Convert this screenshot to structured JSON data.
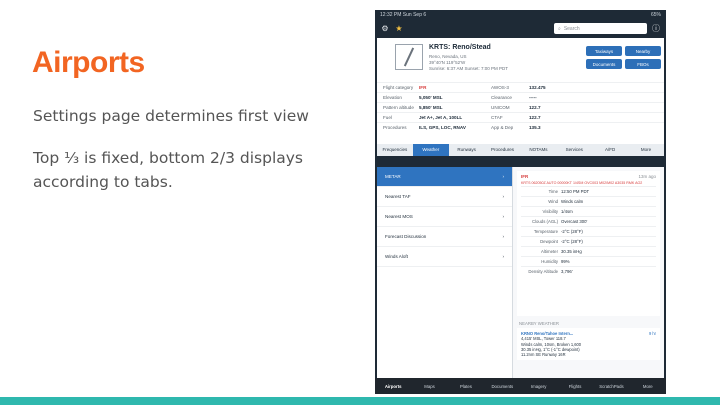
{
  "slide": {
    "title": "Airports",
    "line1": "Settings page determines first view",
    "line2": "Top ⅓ is fixed, bottom 2/3 displays according to tabs."
  },
  "colors": {
    "title": "#f26522",
    "accent_bar": "#2fb8ae",
    "ipad_bg": "#1e2a36",
    "active_blue": "#2f74c0"
  },
  "ipad": {
    "status_left": "12:32 PM  Sun Sep 6",
    "status_right": "65%",
    "search_placeholder": "Search",
    "airport": {
      "title": "KRTS: Reno/Stead",
      "line1": "Reno, Nevada, US",
      "line2": "39°40'N 119°52'W",
      "line3": "Sunrise: 6:37 AM  Sunset: 7:00 PM PDT"
    },
    "buttons": [
      "Taxiways",
      "Nearby",
      "Documents",
      "FBOs"
    ],
    "grid": [
      {
        "l1": "Flight category",
        "v1": "IFR",
        "l2": "AWOS-3",
        "v2": "132.475"
      },
      {
        "l1": "Elevation",
        "v1": "5,050' MSL",
        "l2": "Clearance",
        "v2": "-----"
      },
      {
        "l1": "Pattern altitude",
        "v1": "5,850' MSL",
        "l2": "UNICOM",
        "v2": "122.7"
      },
      {
        "l1": "Fuel",
        "v1": "Jet A+, Jet A, 100LL",
        "l2": "CTAF",
        "v2": "122.7"
      },
      {
        "l1": "Procedures",
        "v1": "ILS, GPS, LOC, RNAV",
        "l2": "App & Dep",
        "v2": "135.3"
      }
    ],
    "tabs": [
      "Frequencies",
      "Weather",
      "Runways",
      "Procedures",
      "NOTAMs",
      "Services",
      "A/FD",
      "More"
    ],
    "left_items": [
      "METAR",
      "Nearest TAF",
      "Nearest MOS",
      "Forecast Discussion",
      "Winds Aloft"
    ],
    "metar": {
      "flag": "IFR",
      "age": "13m ago",
      "raw": "KRTS 062050Z AUTO 00000KT 1/4SM OVC003 M02/M02 A3035 RMK AO2",
      "rows": [
        {
          "k": "Time",
          "v": "12:50 PM PDT"
        },
        {
          "k": "Wind",
          "v": "Winds calm"
        },
        {
          "k": "Visibility",
          "v": "1/4sm"
        },
        {
          "k": "Clouds (AGL)",
          "v": "Overcast 300'"
        },
        {
          "k": "Temperature",
          "v": "-2°C (28°F)"
        },
        {
          "k": "Dewpoint",
          "v": "-2°C (28°F)"
        },
        {
          "k": "Altimeter",
          "v": "30.35 inHg"
        },
        {
          "k": "Humidity",
          "v": "99%"
        },
        {
          "k": "Density Altitude",
          "v": "3,796'"
        }
      ]
    },
    "nearby_label": "NEARBY WEATHER",
    "nearby": {
      "title": "KRNO Reno/Tahoe Intern...",
      "time": "9 hr",
      "line1": "4,415' MSL, Tower 118.7",
      "line2": "Winds calm, 10sm, Broken 1,600",
      "line3": "30.35 inHg, 1°C (-1°C dewpoint)",
      "line4": "11.2nm SE  Runway 16R"
    },
    "bottom_nav": [
      "Airports",
      "Maps",
      "Plates",
      "Documents",
      "Imagery",
      "Flights",
      "ScratchPads",
      "More"
    ]
  }
}
